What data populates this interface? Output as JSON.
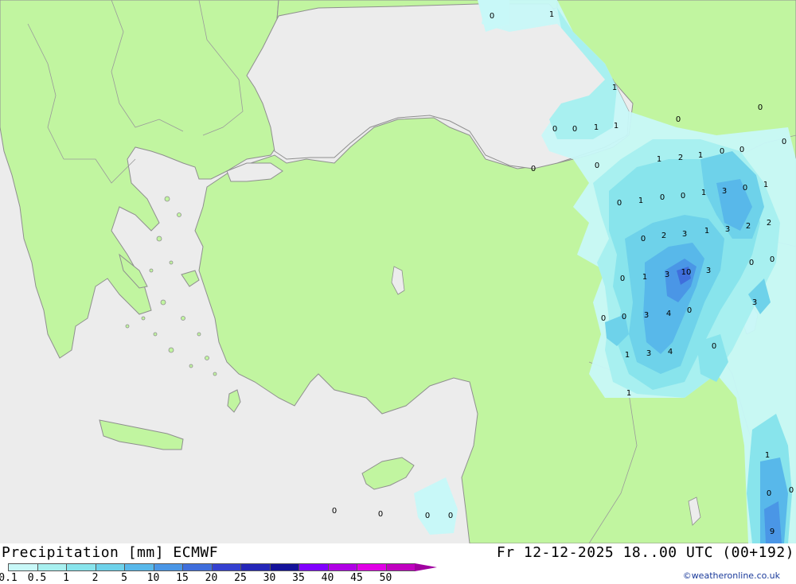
{
  "footer": {
    "title": "Precipitation [mm] ECMWF",
    "datetime": "Fr 12-12-2025 18..00 UTC (00+192)",
    "credit": "©weatheronline.co.uk"
  },
  "legend": {
    "ticks": [
      "0.1",
      "0.5",
      "1",
      "2",
      "5",
      "10",
      "15",
      "20",
      "25",
      "30",
      "35",
      "40",
      "45",
      "50"
    ],
    "colors": [
      "#c8f8f8",
      "#a8f0f0",
      "#88e4ec",
      "#6ed2ea",
      "#58b8ea",
      "#4a96e6",
      "#3f6edc",
      "#3440d0",
      "#2426b8",
      "#14129a",
      "#8000ff",
      "#b000e6",
      "#e000e6",
      "#c000c0"
    ]
  },
  "colors": {
    "land": "#c1f5a0",
    "sea": "#ececec",
    "border": "#9a9a9a"
  },
  "precip_labels": [
    {
      "v": "0"
    },
    {
      "v": "1"
    },
    {
      "v": "1"
    },
    {
      "v": "0"
    },
    {
      "v": "0"
    },
    {
      "v": "1"
    },
    {
      "v": "1"
    },
    {
      "v": "0"
    },
    {
      "v": "0"
    },
    {
      "v": "0"
    },
    {
      "v": "0"
    },
    {
      "v": "0"
    },
    {
      "v": "1"
    },
    {
      "v": "2"
    },
    {
      "v": "1"
    },
    {
      "v": "0"
    },
    {
      "v": "0"
    },
    {
      "v": "0"
    },
    {
      "v": "1"
    },
    {
      "v": "0"
    },
    {
      "v": "0"
    },
    {
      "v": "1"
    },
    {
      "v": "3"
    },
    {
      "v": "0"
    },
    {
      "v": "1"
    },
    {
      "v": "0"
    },
    {
      "v": "2"
    },
    {
      "v": "3"
    },
    {
      "v": "1"
    },
    {
      "v": "3"
    },
    {
      "v": "2"
    },
    {
      "v": "2"
    },
    {
      "v": "0"
    },
    {
      "v": "0"
    },
    {
      "v": "0"
    },
    {
      "v": "1"
    },
    {
      "v": "3"
    },
    {
      "v": "10"
    },
    {
      "v": "3"
    },
    {
      "v": "3"
    },
    {
      "v": "0"
    },
    {
      "v": "0"
    },
    {
      "v": "3"
    },
    {
      "v": "4"
    },
    {
      "v": "0"
    },
    {
      "v": "1"
    },
    {
      "v": "3"
    },
    {
      "v": "4"
    },
    {
      "v": "0"
    },
    {
      "v": "1"
    },
    {
      "v": "1"
    },
    {
      "v": "0"
    },
    {
      "v": "0"
    },
    {
      "v": "9"
    },
    {
      "v": "0"
    },
    {
      "v": "0"
    },
    {
      "v": "0"
    },
    {
      "v": "0"
    }
  ]
}
